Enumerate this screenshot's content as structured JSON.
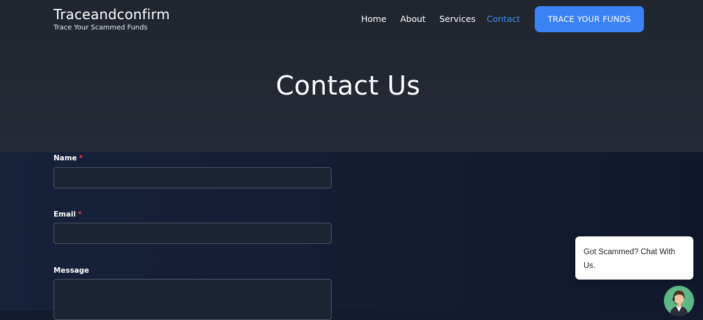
{
  "brand": {
    "title": "Traceandconfirm",
    "tagline": "Trace Your Scammed Funds"
  },
  "nav": {
    "items": [
      {
        "label": "Home",
        "active": false
      },
      {
        "label": "About",
        "active": false
      },
      {
        "label": "Services",
        "active": false
      },
      {
        "label": "Contact",
        "active": true
      }
    ],
    "cta_label": "TRACE YOUR FUNDS"
  },
  "hero": {
    "title": "Contact Us"
  },
  "form": {
    "name_label": "Name",
    "email_label": "Email",
    "message_label": "Message",
    "required_marker": "*",
    "name_value": "",
    "email_value": "",
    "message_value": ""
  },
  "chat": {
    "text": "Got Scammed? Chat With Us.",
    "avatar_icon": "support-agent-icon"
  },
  "colors": {
    "accent": "#3b82f6",
    "active_nav": "#3d8bf6",
    "required": "#e0444a",
    "hero_bg": "#232833",
    "form_bg": "#151d33",
    "avatar_bg": "#5cb885"
  }
}
